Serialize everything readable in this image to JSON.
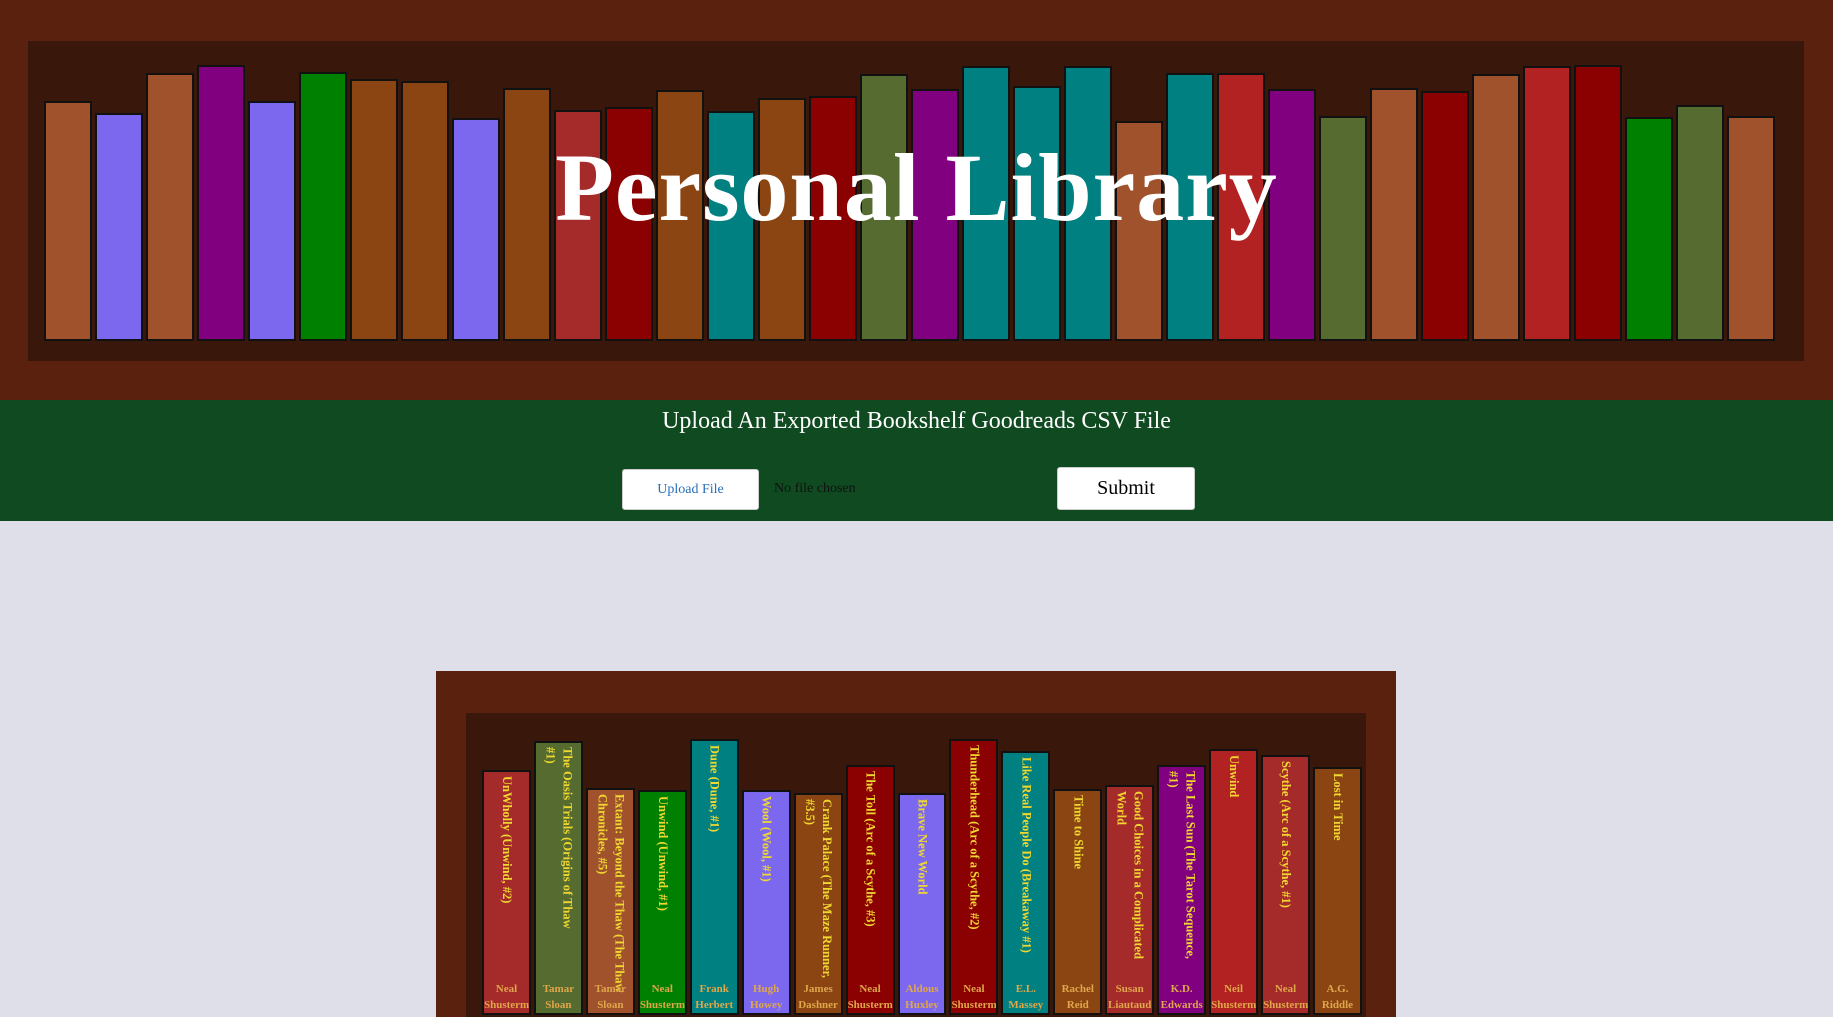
{
  "header": {
    "title": "Personal Library",
    "books": [
      {
        "color": "#a0522d",
        "h": 240
      },
      {
        "color": "#7b68ee",
        "h": 228
      },
      {
        "color": "#a0522d",
        "h": 268
      },
      {
        "color": "#800080",
        "h": 276
      },
      {
        "color": "#7b68ee",
        "h": 240
      },
      {
        "color": "#008000",
        "h": 269
      },
      {
        "color": "#8b4513",
        "h": 262
      },
      {
        "color": "#8b4513",
        "h": 260
      },
      {
        "color": "#7b68ee",
        "h": 223
      },
      {
        "color": "#8b4513",
        "h": 253
      },
      {
        "color": "#a52a2a",
        "h": 231
      },
      {
        "color": "#8b0000",
        "h": 234
      },
      {
        "color": "#8b4513",
        "h": 251
      },
      {
        "color": "#008080",
        "h": 230
      },
      {
        "color": "#8b4513",
        "h": 243
      },
      {
        "color": "#8b0000",
        "h": 245
      },
      {
        "color": "#556b2f",
        "h": 267
      },
      {
        "color": "#800080",
        "h": 252
      },
      {
        "color": "#008080",
        "h": 275
      },
      {
        "color": "#008080",
        "h": 255
      },
      {
        "color": "#008080",
        "h": 275
      },
      {
        "color": "#a0522d",
        "h": 220
      },
      {
        "color": "#008080",
        "h": 268
      },
      {
        "color": "#b22222",
        "h": 268
      },
      {
        "color": "#800080",
        "h": 252
      },
      {
        "color": "#556b2f",
        "h": 225
      },
      {
        "color": "#a0522d",
        "h": 253
      },
      {
        "color": "#8b0000",
        "h": 250
      },
      {
        "color": "#a0522d",
        "h": 267
      },
      {
        "color": "#b22222",
        "h": 275
      },
      {
        "color": "#8b0000",
        "h": 276
      },
      {
        "color": "#008000",
        "h": 224
      },
      {
        "color": "#556b2f",
        "h": 236
      },
      {
        "color": "#a0522d",
        "h": 225
      }
    ]
  },
  "upload": {
    "heading": "Upload An Exported Bookshelf Goodreads CSV File",
    "upload_label": "Upload File",
    "file_status": "No file chosen",
    "submit_label": "Submit"
  },
  "shelf": {
    "books": [
      {
        "title": "UnWholly (Unwind, #2)",
        "author": "Neal Shusterman",
        "color": "#a52a2a",
        "h": 245
      },
      {
        "title": "The Oasis Trials (Origins of Thaw #1)",
        "author": "Tamar Sloan",
        "color": "#556b2f",
        "h": 274
      },
      {
        "title": "Extant: Beyond the Thaw (The Thaw Chronicles, #5)",
        "author": "Tamar Sloan",
        "color": "#a0522d",
        "h": 227
      },
      {
        "title": "Unwind (Unwind, #1)",
        "author": "Neal Shusterman",
        "color": "#008000",
        "h": 225
      },
      {
        "title": "Dune (Dune, #1)",
        "author": "Frank Herbert",
        "color": "#008080",
        "h": 276
      },
      {
        "title": "Wool (Wool, #1)",
        "author": "Hugh Howey",
        "color": "#7b68ee",
        "h": 225
      },
      {
        "title": "Crank Palace (The Maze Runner, #3.5)",
        "author": "James Dashner",
        "color": "#8b4513",
        "h": 222
      },
      {
        "title": "The Toll (Arc of a Scythe, #3)",
        "author": "Neal Shusterman",
        "color": "#8b0000",
        "h": 250
      },
      {
        "title": "Brave New World",
        "author": "Aldous Huxley",
        "color": "#7b68ee",
        "h": 222
      },
      {
        "title": "Thunderhead (Arc of a Scythe, #2)",
        "author": "Neal Shusterman",
        "color": "#8b0000",
        "h": 276
      },
      {
        "title": "Like Real People Do (Breakaway #1)",
        "author": "E.L. Massey",
        "color": "#008080",
        "h": 264
      },
      {
        "title": "Time to Shine",
        "author": "Rachel Reid",
        "color": "#8b4513",
        "h": 226
      },
      {
        "title": "Good Choices in a Complicated World",
        "author": "Susan Liautaud",
        "color": "#a52a2a",
        "h": 230
      },
      {
        "title": "The Last Sun (The Tarot Sequence, #1)",
        "author": "K.D. Edwards",
        "color": "#800080",
        "h": 250
      },
      {
        "title": "Unwind",
        "author": "Neil Shusterman",
        "color": "#b22222",
        "h": 266
      },
      {
        "title": "Scythe (Arc of a Scythe, #1)",
        "author": "Neal Shusterman",
        "color": "#a52a2a",
        "h": 260
      },
      {
        "title": "Lost in Time",
        "author": "A.G. Riddle",
        "color": "#8b4513",
        "h": 248
      }
    ]
  }
}
